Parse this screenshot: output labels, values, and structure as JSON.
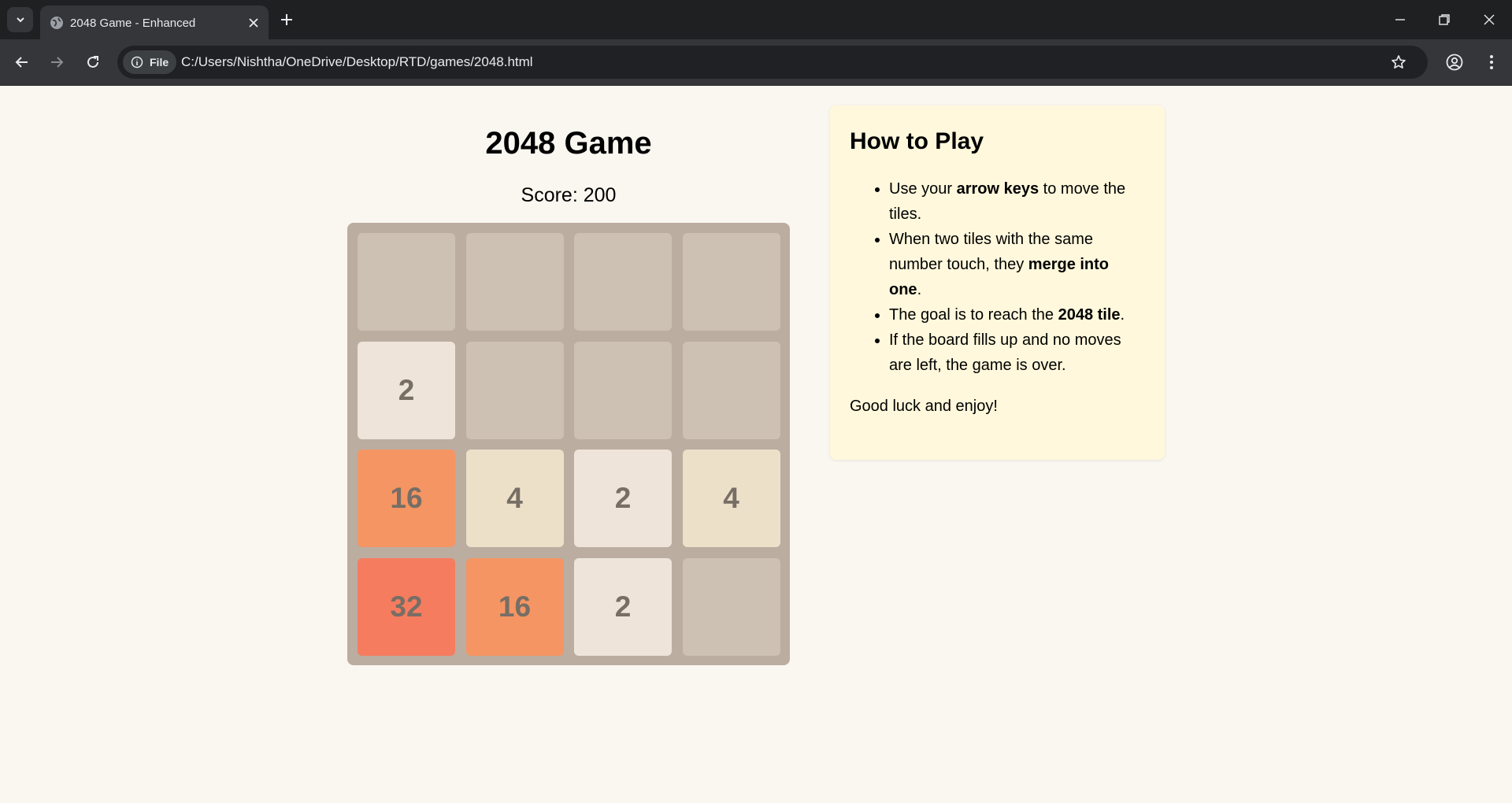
{
  "browser": {
    "tab_title": "2048 Game - Enhanced",
    "file_chip": "File",
    "url": "C:/Users/Nishtha/OneDrive/Desktop/RTD/games/2048.html"
  },
  "game": {
    "title": "2048 Game",
    "score_label": "Score:",
    "score": "200",
    "board": [
      [
        "",
        "",
        "",
        ""
      ],
      [
        "2",
        "",
        "",
        ""
      ],
      [
        "16",
        "4",
        "2",
        "4"
      ],
      [
        "32",
        "16",
        "2",
        ""
      ]
    ]
  },
  "instructions": {
    "title": "How to Play",
    "items": [
      {
        "parts": [
          {
            "t": "Use your "
          },
          {
            "t": "arrow keys",
            "b": true
          },
          {
            "t": " to move the tiles."
          }
        ]
      },
      {
        "parts": [
          {
            "t": "When two tiles with the same number touch, they "
          },
          {
            "t": "merge into one",
            "b": true
          },
          {
            "t": "."
          }
        ]
      },
      {
        "parts": [
          {
            "t": "The goal is to reach the "
          },
          {
            "t": "2048 tile",
            "b": true
          },
          {
            "t": "."
          }
        ]
      },
      {
        "parts": [
          {
            "t": "If the board fills up and no moves are left, the game is over."
          }
        ]
      }
    ],
    "footer": "Good luck and enjoy!"
  },
  "tile_colors": {
    "empty": "#cdc1b4",
    "2": "#eee4da",
    "4": "#ede0c8",
    "16": "#f59563",
    "32": "#f67c5f"
  }
}
